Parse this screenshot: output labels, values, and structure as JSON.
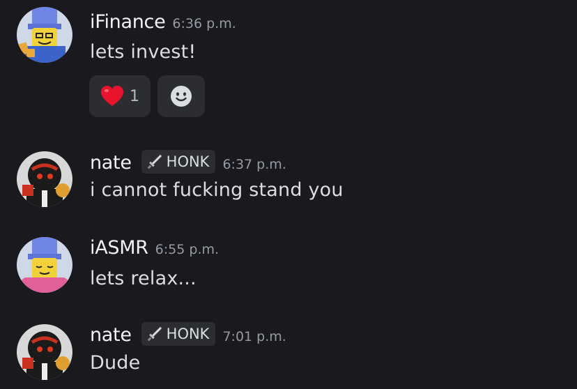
{
  "messages": [
    {
      "author": "iFinance",
      "timestamp": "6:36 p.m.",
      "text": "lets invest!",
      "reactions": [
        {
          "emoji": "heart-emoji",
          "count": "1"
        }
      ],
      "add_reaction_icon": "smiley-face-icon"
    },
    {
      "author": "nate",
      "tag": "HONK",
      "tag_icon": "sword-icon",
      "timestamp": "6:37 p.m.",
      "text": "i cannot fucking stand you"
    },
    {
      "author": "iASMR",
      "timestamp": "6:55 p.m.",
      "text": "lets relax..."
    },
    {
      "author": "nate",
      "tag": "HONK",
      "tag_icon": "sword-icon",
      "timestamp": "7:01 p.m.",
      "text": "Dude"
    }
  ],
  "colors": {
    "background": "#1a1a1e",
    "username": "#f2f3f5",
    "text": "#dbdee1",
    "timestamp": "#949ba4",
    "pill": "#2b2d31",
    "heart": "#e8132d"
  }
}
